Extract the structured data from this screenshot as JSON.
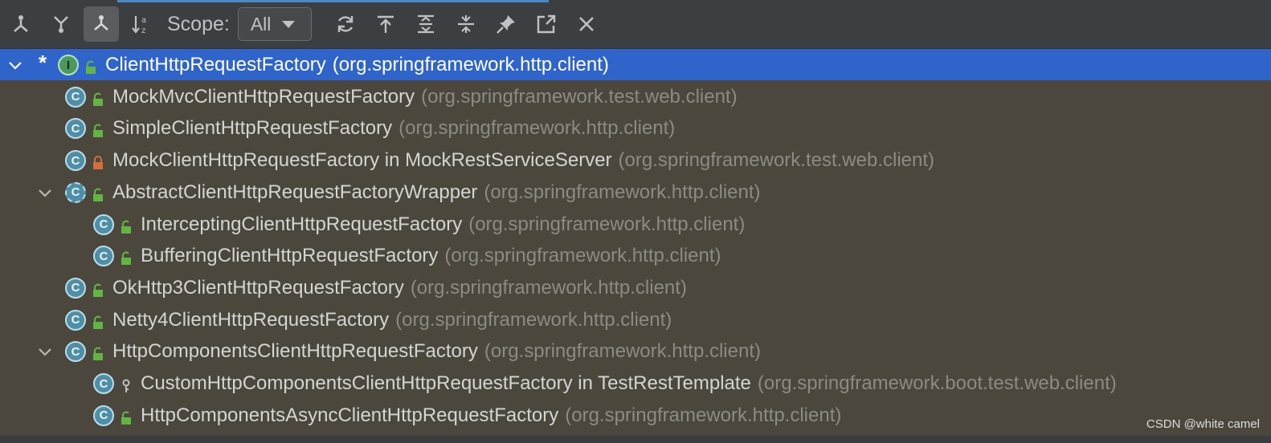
{
  "toolbar": {
    "buttons": [
      {
        "name": "supertypes-hierarchy-icon",
        "active": false
      },
      {
        "name": "subtypes-hierarchy-icon",
        "active": false
      },
      {
        "name": "class-hierarchy-icon",
        "active": true
      },
      {
        "name": "sort-alphabetically-icon",
        "active": false
      }
    ],
    "scope_label": "Scope:",
    "scope_value": "All",
    "actions": [
      "refresh-icon",
      "scroll-to-source-icon",
      "expand-all-icon",
      "collapse-all-icon",
      "pin-icon",
      "export-icon",
      "close-icon"
    ]
  },
  "tree": {
    "rows": [
      {
        "expand": "open",
        "star": true,
        "kind": "I",
        "access": "public",
        "name": "ClientHttpRequestFactory",
        "package": "(org.springframework.http.client)",
        "selected": true,
        "indent": 0
      },
      {
        "expand": null,
        "kind": "C",
        "access": "public",
        "name": "MockMvcClientHttpRequestFactory",
        "package": "(org.springframework.test.web.client)",
        "indent": 1
      },
      {
        "expand": null,
        "kind": "C",
        "access": "public",
        "name": "SimpleClientHttpRequestFactory",
        "package": "(org.springframework.http.client)",
        "indent": 1
      },
      {
        "expand": null,
        "kind": "C",
        "access": "private",
        "name": "MockClientHttpRequestFactory in MockRestServiceServer",
        "package": "(org.springframework.test.web.client)",
        "indent": 1
      },
      {
        "expand": "open",
        "kind": "C",
        "abstract": true,
        "access": "public",
        "name": "AbstractClientHttpRequestFactoryWrapper",
        "package": "(org.springframework.http.client)",
        "indent": 1
      },
      {
        "expand": null,
        "kind": "C",
        "access": "public",
        "name": "InterceptingClientHttpRequestFactory",
        "package": "(org.springframework.http.client)",
        "indent": 2
      },
      {
        "expand": null,
        "kind": "C",
        "access": "public",
        "name": "BufferingClientHttpRequestFactory",
        "package": "(org.springframework.http.client)",
        "indent": 2
      },
      {
        "expand": null,
        "kind": "C",
        "access": "public",
        "name": "OkHttp3ClientHttpRequestFactory",
        "package": "(org.springframework.http.client)",
        "indent": 1
      },
      {
        "expand": null,
        "kind": "C",
        "access": "public",
        "name": "Netty4ClientHttpRequestFactory",
        "package": "(org.springframework.http.client)",
        "indent": 1
      },
      {
        "expand": "open",
        "kind": "C",
        "access": "public",
        "name": "HttpComponentsClientHttpRequestFactory",
        "package": "(org.springframework.http.client)",
        "indent": 1
      },
      {
        "expand": null,
        "kind": "C",
        "access": "package",
        "name": "CustomHttpComponentsClientHttpRequestFactory in TestRestTemplate",
        "package": "(org.springframework.boot.test.web.client)",
        "indent": 2
      },
      {
        "expand": null,
        "kind": "C",
        "access": "public",
        "name": "HttpComponentsAsyncClientHttpRequestFactory",
        "package": "(org.springframework.http.client)",
        "indent": 2
      }
    ]
  },
  "watermark": "CSDN @white camel"
}
